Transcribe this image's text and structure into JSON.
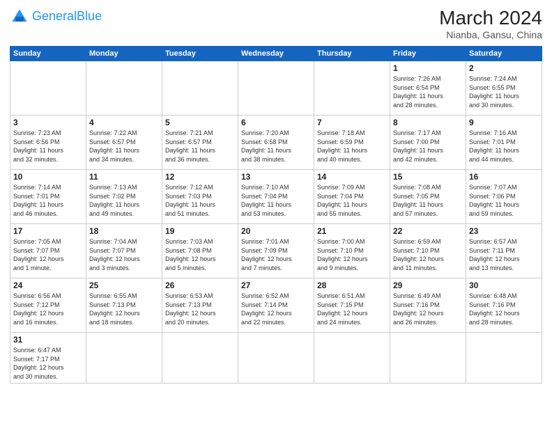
{
  "header": {
    "logo_general": "General",
    "logo_blue": "Blue",
    "title": "March 2024",
    "subtitle": "Nianba, Gansu, China"
  },
  "weekdays": [
    "Sunday",
    "Monday",
    "Tuesday",
    "Wednesday",
    "Thursday",
    "Friday",
    "Saturday"
  ],
  "rows": [
    [
      {
        "day": "",
        "info": "",
        "empty": true
      },
      {
        "day": "",
        "info": "",
        "empty": true
      },
      {
        "day": "",
        "info": "",
        "empty": true
      },
      {
        "day": "",
        "info": "",
        "empty": true
      },
      {
        "day": "",
        "info": "",
        "empty": true
      },
      {
        "day": "1",
        "info": "Sunrise: 7:26 AM\nSunset: 6:54 PM\nDaylight: 11 hours\nand 28 minutes."
      },
      {
        "day": "2",
        "info": "Sunrise: 7:24 AM\nSunset: 6:55 PM\nDaylight: 11 hours\nand 30 minutes."
      }
    ],
    [
      {
        "day": "3",
        "info": "Sunrise: 7:23 AM\nSunset: 6:56 PM\nDaylight: 11 hours\nand 32 minutes."
      },
      {
        "day": "4",
        "info": "Sunrise: 7:22 AM\nSunset: 6:57 PM\nDaylight: 11 hours\nand 34 minutes."
      },
      {
        "day": "5",
        "info": "Sunrise: 7:21 AM\nSunset: 6:57 PM\nDaylight: 11 hours\nand 36 minutes."
      },
      {
        "day": "6",
        "info": "Sunrise: 7:20 AM\nSunset: 6:58 PM\nDaylight: 11 hours\nand 38 minutes."
      },
      {
        "day": "7",
        "info": "Sunrise: 7:18 AM\nSunset: 6:59 PM\nDaylight: 11 hours\nand 40 minutes."
      },
      {
        "day": "8",
        "info": "Sunrise: 7:17 AM\nSunset: 7:00 PM\nDaylight: 11 hours\nand 42 minutes."
      },
      {
        "day": "9",
        "info": "Sunrise: 7:16 AM\nSunset: 7:01 PM\nDaylight: 11 hours\nand 44 minutes."
      }
    ],
    [
      {
        "day": "10",
        "info": "Sunrise: 7:14 AM\nSunset: 7:01 PM\nDaylight: 11 hours\nand 46 minutes."
      },
      {
        "day": "11",
        "info": "Sunrise: 7:13 AM\nSunset: 7:02 PM\nDaylight: 11 hours\nand 49 minutes."
      },
      {
        "day": "12",
        "info": "Sunrise: 7:12 AM\nSunset: 7:03 PM\nDaylight: 11 hours\nand 51 minutes."
      },
      {
        "day": "13",
        "info": "Sunrise: 7:10 AM\nSunset: 7:04 PM\nDaylight: 11 hours\nand 53 minutes."
      },
      {
        "day": "14",
        "info": "Sunrise: 7:09 AM\nSunset: 7:04 PM\nDaylight: 11 hours\nand 55 minutes."
      },
      {
        "day": "15",
        "info": "Sunrise: 7:08 AM\nSunset: 7:05 PM\nDaylight: 11 hours\nand 57 minutes."
      },
      {
        "day": "16",
        "info": "Sunrise: 7:07 AM\nSunset: 7:06 PM\nDaylight: 11 hours\nand 59 minutes."
      }
    ],
    [
      {
        "day": "17",
        "info": "Sunrise: 7:05 AM\nSunset: 7:07 PM\nDaylight: 12 hours\nand 1 minute."
      },
      {
        "day": "18",
        "info": "Sunrise: 7:04 AM\nSunset: 7:07 PM\nDaylight: 12 hours\nand 3 minutes."
      },
      {
        "day": "19",
        "info": "Sunrise: 7:03 AM\nSunset: 7:08 PM\nDaylight: 12 hours\nand 5 minutes."
      },
      {
        "day": "20",
        "info": "Sunrise: 7:01 AM\nSunset: 7:09 PM\nDaylight: 12 hours\nand 7 minutes."
      },
      {
        "day": "21",
        "info": "Sunrise: 7:00 AM\nSunset: 7:10 PM\nDaylight: 12 hours\nand 9 minutes."
      },
      {
        "day": "22",
        "info": "Sunrise: 6:59 AM\nSunset: 7:10 PM\nDaylight: 12 hours\nand 11 minutes."
      },
      {
        "day": "23",
        "info": "Sunrise: 6:57 AM\nSunset: 7:11 PM\nDaylight: 12 hours\nand 13 minutes."
      }
    ],
    [
      {
        "day": "24",
        "info": "Sunrise: 6:56 AM\nSunset: 7:12 PM\nDaylight: 12 hours\nand 16 minutes."
      },
      {
        "day": "25",
        "info": "Sunrise: 6:55 AM\nSunset: 7:13 PM\nDaylight: 12 hours\nand 18 minutes."
      },
      {
        "day": "26",
        "info": "Sunrise: 6:53 AM\nSunset: 7:13 PM\nDaylight: 12 hours\nand 20 minutes."
      },
      {
        "day": "27",
        "info": "Sunrise: 6:52 AM\nSunset: 7:14 PM\nDaylight: 12 hours\nand 22 minutes."
      },
      {
        "day": "28",
        "info": "Sunrise: 6:51 AM\nSunset: 7:15 PM\nDaylight: 12 hours\nand 24 minutes."
      },
      {
        "day": "29",
        "info": "Sunrise: 6:49 AM\nSunset: 7:16 PM\nDaylight: 12 hours\nand 26 minutes."
      },
      {
        "day": "30",
        "info": "Sunrise: 6:48 AM\nSunset: 7:16 PM\nDaylight: 12 hours\nand 28 minutes."
      }
    ],
    [
      {
        "day": "31",
        "info": "Sunrise: 6:47 AM\nSunset: 7:17 PM\nDaylight: 12 hours\nand 30 minutes."
      },
      {
        "day": "",
        "info": "",
        "empty": true
      },
      {
        "day": "",
        "info": "",
        "empty": true
      },
      {
        "day": "",
        "info": "",
        "empty": true
      },
      {
        "day": "",
        "info": "",
        "empty": true
      },
      {
        "day": "",
        "info": "",
        "empty": true
      },
      {
        "day": "",
        "info": "",
        "empty": true
      }
    ]
  ]
}
